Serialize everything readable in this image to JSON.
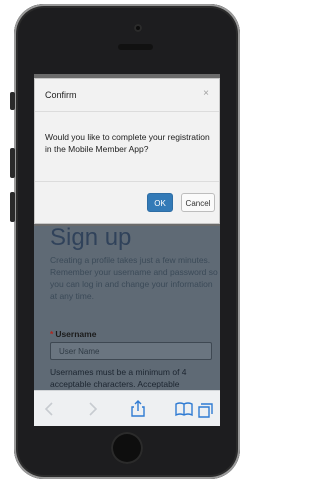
{
  "modal": {
    "title": "Confirm",
    "close_label": "×",
    "message": "Would you like to complete your registration in the Mobile Member App?",
    "ok_label": "OK",
    "cancel_label": "Cancel"
  },
  "page": {
    "heading": "Sign up",
    "description": "Creating a profile takes just a few minutes. Remember your username and password so you can log in and change your information at any time.",
    "username_required_marker": "*",
    "username_label": "Username",
    "username_placeholder": "User Name",
    "username_hint": "Usernames must be a minimum of 4 acceptable characters. Acceptable"
  },
  "toolbar": {
    "icons": [
      "back-icon",
      "forward-icon",
      "share-icon",
      "bookmarks-icon",
      "tabs-icon"
    ]
  },
  "colors": {
    "ok_button": "#337ab7",
    "phone_body": "#1d1d1f",
    "toolbar_icon_active": "#2f7bd3"
  }
}
